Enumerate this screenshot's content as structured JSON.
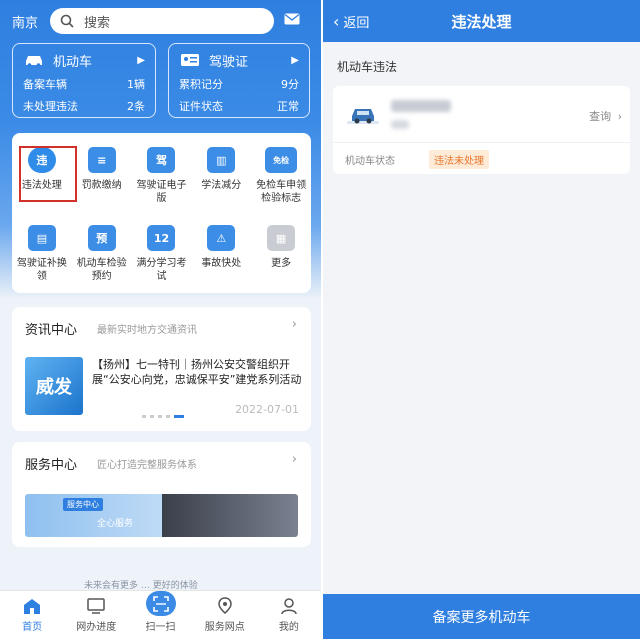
{
  "left": {
    "city": "南京",
    "search_placeholder": "搜索",
    "vehicle_card": {
      "title": "机动车",
      "rows": [
        {
          "label": "备案车辆",
          "value": "1辆"
        },
        {
          "label": "未处理违法",
          "value": "2条"
        }
      ]
    },
    "license_card": {
      "title": "驾驶证",
      "rows": [
        {
          "label": "累积记分",
          "value": "9分"
        },
        {
          "label": "证件状态",
          "value": "正常"
        }
      ]
    },
    "services": [
      {
        "label": "违法处理",
        "icon": "violation-icon",
        "glyph": "违"
      },
      {
        "label": "罚款缴纳",
        "icon": "fine-icon",
        "glyph": "≡"
      },
      {
        "label": "驾驶证电子版",
        "icon": "e-license-icon",
        "glyph": "驾"
      },
      {
        "label": "学法减分",
        "icon": "study-icon",
        "glyph": "▥"
      },
      {
        "label": "免检车申领检验标志",
        "icon": "exempt-icon",
        "glyph": "免检"
      },
      {
        "label": "驾驶证补换领",
        "icon": "license-renew-icon",
        "glyph": "▤"
      },
      {
        "label": "机动车检验预约",
        "icon": "inspection-icon",
        "glyph": "预"
      },
      {
        "label": "满分学习考试",
        "icon": "calendar-icon",
        "glyph": "12"
      },
      {
        "label": "事故快处",
        "icon": "accident-icon",
        "glyph": "⚠"
      },
      {
        "label": "更多",
        "icon": "more-icon",
        "glyph": "▦"
      }
    ],
    "news": {
      "title": "资讯中心",
      "subtitle": "最新实时地方交通资讯",
      "thumb_text": "威发",
      "headline": "【扬州】七一特刊｜扬州公安交警组织开展“公安心向党，忠诚保平安”建党系列活动",
      "date": "2022-07-01"
    },
    "service_center": {
      "title": "服务中心",
      "subtitle": "匠心打造完整服务体系",
      "banner_tag": "服务中心",
      "banner_text": "全心服务"
    },
    "footer_note": "未来会有更多 … 更好的体验",
    "tabs": [
      {
        "label": "首页",
        "icon": "home-icon",
        "active": true
      },
      {
        "label": "网办进度",
        "icon": "monitor-icon",
        "active": false
      },
      {
        "label": "扫一扫",
        "icon": "scan-icon",
        "active": false
      },
      {
        "label": "服务网点",
        "icon": "location-icon",
        "active": false
      },
      {
        "label": "我的",
        "icon": "user-icon",
        "active": false
      }
    ]
  },
  "right": {
    "back_label": "返回",
    "title": "违法处理",
    "section_title": "机动车违法",
    "query_label": "查询",
    "status_label": "机动车状态",
    "status_badge": "违法未处理",
    "bottom_button": "备案更多机动车"
  },
  "colors": {
    "primary": "#2f7fe0",
    "alert": "#d2302a",
    "badge_text": "#e8742a"
  }
}
